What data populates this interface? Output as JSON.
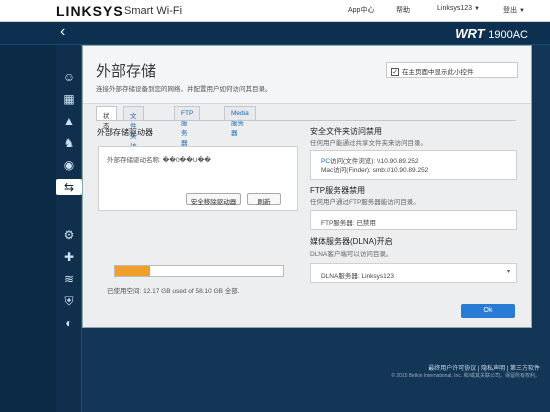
{
  "topbar": {
    "brand": "LINKSYS",
    "product": "Smart Wi-Fi",
    "app_center": "App中心",
    "help": "帮助",
    "router_name": "Linksys123",
    "logout": "登出"
  },
  "header": {
    "model_main": "WRT",
    "model_sub": "1900AC"
  },
  "sidebar": {
    "icons": [
      "widgets-icon",
      "network-map-icon",
      "troubleshoot-icon",
      "parental-icon",
      "media-prioritization-icon",
      "external-storage-icon",
      "connectivity-icon",
      "wireless-icon",
      "security-icon",
      "speed-test-icon"
    ]
  },
  "modal": {
    "title": "外部存储",
    "subtitle": "连接外部存储设备到您的网络，并配置用户如何访问其目录。",
    "dashboard_toggle": "在主页面中显示此小控件",
    "tabs": [
      "状态",
      "文件夹访问",
      "FTP服务器",
      "Media服务器"
    ],
    "ok_label": "Ok"
  },
  "drive": {
    "section_title": "外部存储驱动器",
    "name_label": "外部存储驱动名称: ��0��U��",
    "used_text": "已使用空间: 12.17 GB used of 58.10 GB 全部.",
    "used_fraction": 0.21,
    "eject_label": "安全移除驱动器",
    "refresh_label": "刷新"
  },
  "folder_access": {
    "title": "安全文件夹访问禁用",
    "desc": "任何用户能通过共享文件夹来访问目录。",
    "pc_prefix": "PC",
    "pc_text": "访问(文件浏览): \\\\10.90.89.252",
    "mac_text": "Mac访问(Finder): smb://10.90.89.252"
  },
  "ftp": {
    "title": "FTP服务器禁用",
    "desc": "任何用户通过FTP服务器能访问目录。",
    "status": "FTP服务器: 已禁用"
  },
  "dlna": {
    "title": "媒体服务器(DLNA)开启",
    "desc": "DLNA客户端可以访问目录。",
    "server": "DLNA服务器: Linksys123"
  },
  "footer": {
    "links": "最终用户许可协议 | 隐私声明 | 第三方软件",
    "copyright": "© 2015 Belkin International, Inc. 和/或其关联公司。保留所有权利。"
  },
  "colors": {
    "accent": "#2a7bd6",
    "progress": "#f0a02a",
    "header_bg": "#0d3050"
  }
}
